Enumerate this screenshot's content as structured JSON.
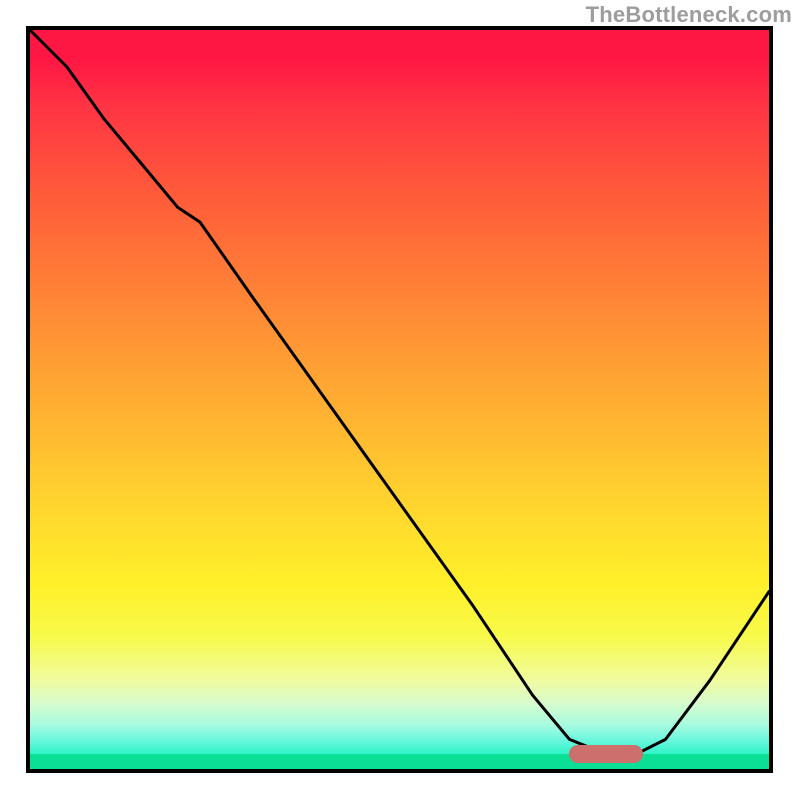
{
  "watermark": "TheBottleneck.com",
  "chart_data": {
    "type": "line",
    "title": "",
    "xlabel": "",
    "ylabel": "",
    "xlim": [
      0,
      100
    ],
    "ylim": [
      0,
      100
    ],
    "series": [
      {
        "name": "bottleneck-curve",
        "x": [
          0,
          5,
          10,
          15,
          20,
          23,
          30,
          40,
          50,
          60,
          68,
          73,
          78,
          82,
          86,
          92,
          100
        ],
        "values": [
          100,
          95,
          88,
          82,
          76,
          74,
          64,
          50,
          36,
          22,
          10,
          4,
          2,
          2,
          4,
          12,
          24
        ]
      }
    ],
    "marker": {
      "name": "optimal-range",
      "x_start": 73,
      "x_end": 83,
      "y": 2,
      "color": "#cd6f6c"
    },
    "background_gradient": {
      "top_color": "#ff1744",
      "mid_color": "#ffe227",
      "bottom_color": "#0adf95"
    }
  }
}
